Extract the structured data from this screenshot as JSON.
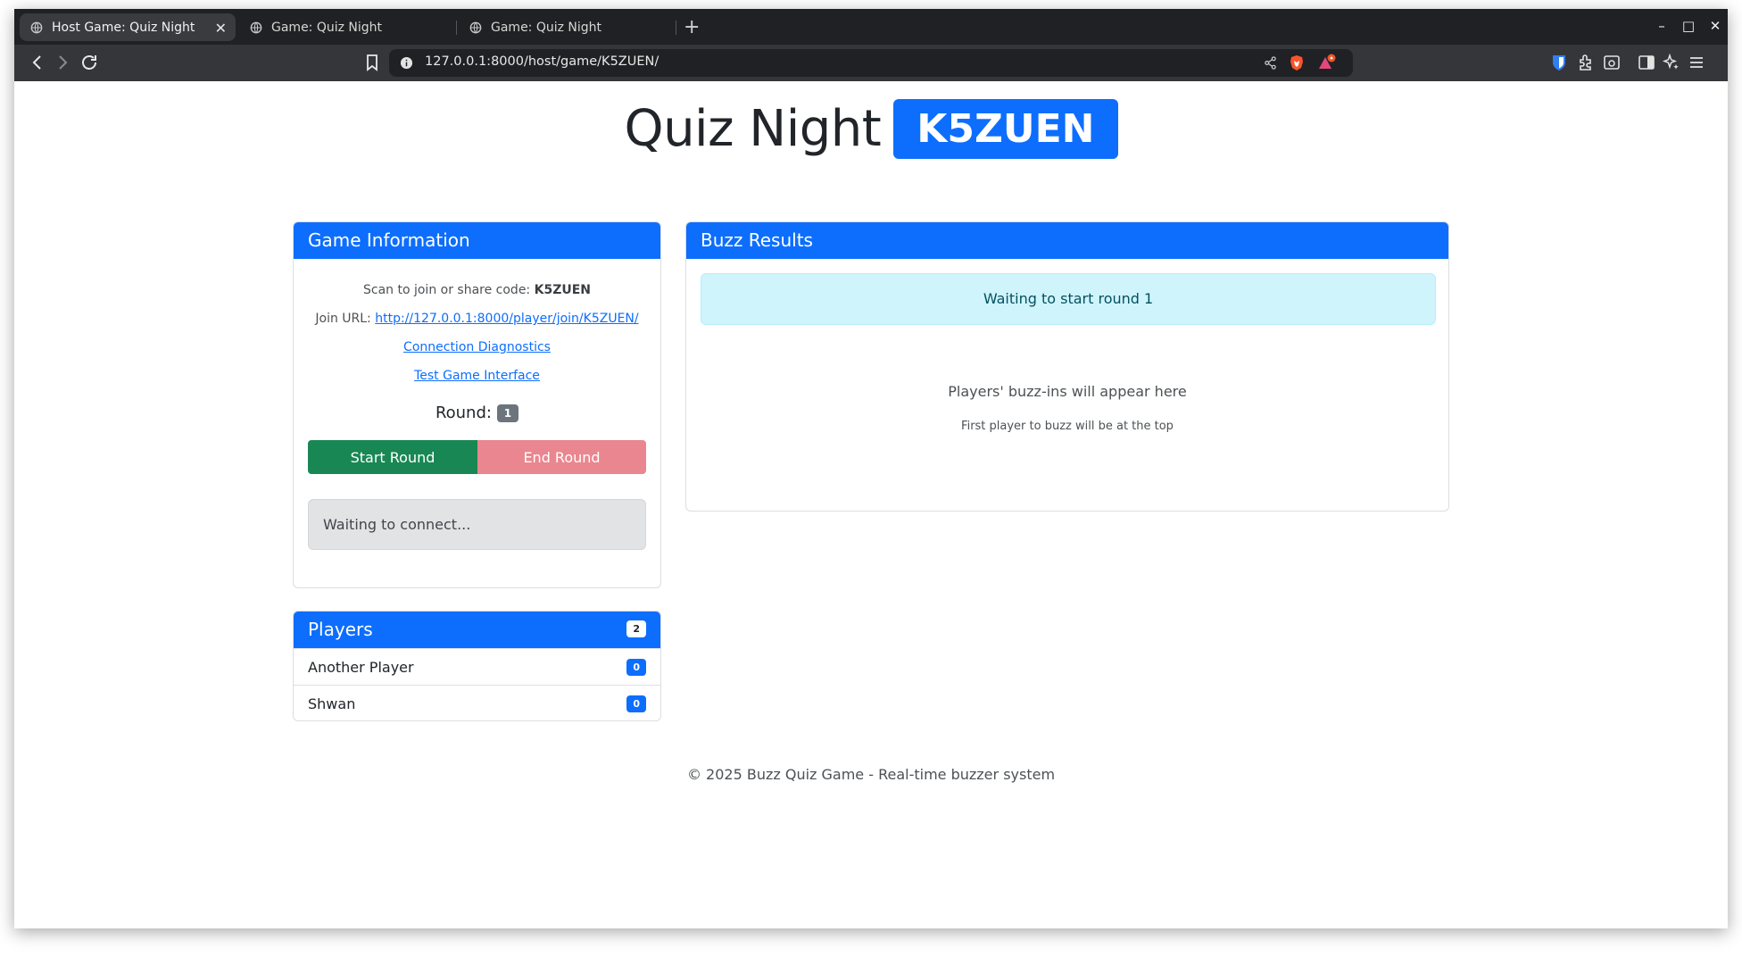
{
  "browser": {
    "tabs": [
      {
        "label": "Host Game: Quiz Night"
      },
      {
        "label": "Game: Quiz Night"
      },
      {
        "label": "Game: Quiz Night"
      }
    ],
    "url": "127.0.0.1:8000/host/game/K5ZUEN/"
  },
  "header": {
    "title": "Quiz Night",
    "code": "K5ZUEN"
  },
  "game_info": {
    "title": "Game Information",
    "scan_prefix": "Scan to join or share code: ",
    "scan_code": "K5ZUEN",
    "join_prefix": "Join URL: ",
    "join_url": "http://127.0.0.1:8000/player/join/K5ZUEN/",
    "diagnostics_link": "Connection Diagnostics",
    "test_link": "Test Game Interface",
    "round_label": "Round:",
    "round_value": "1",
    "start_button": "Start Round",
    "end_button": "End Round",
    "status": "Waiting to connect..."
  },
  "players": {
    "title": "Players",
    "count": "2",
    "list": [
      {
        "name": "Another Player",
        "score": "0"
      },
      {
        "name": "Shwan",
        "score": "0"
      }
    ]
  },
  "buzz": {
    "title": "Buzz Results",
    "alert": "Waiting to start round 1",
    "placeholder": "Players' buzz-ins will appear here",
    "hint": "First player to buzz will be at the top"
  },
  "footer": {
    "text": "© 2025 Buzz Quiz Game - Real-time buzzer system"
  },
  "colors": {
    "primary": "#0d6efd",
    "success": "#198754",
    "danger_light": "#ea868f",
    "info_bg": "#cff4fc"
  },
  "icons": [
    "globe-icon",
    "close-icon",
    "plus-icon",
    "back-icon",
    "forward-icon",
    "reload-icon",
    "bookmark-icon",
    "site-info-icon",
    "share-icon",
    "brave-shield-icon",
    "rewards-icon",
    "bitwarden-icon",
    "extensions-icon",
    "tab-search-icon",
    "sidebar-icon",
    "leo-icon",
    "menu-icon",
    "minimize-icon",
    "maximize-icon",
    "window-close-icon"
  ]
}
